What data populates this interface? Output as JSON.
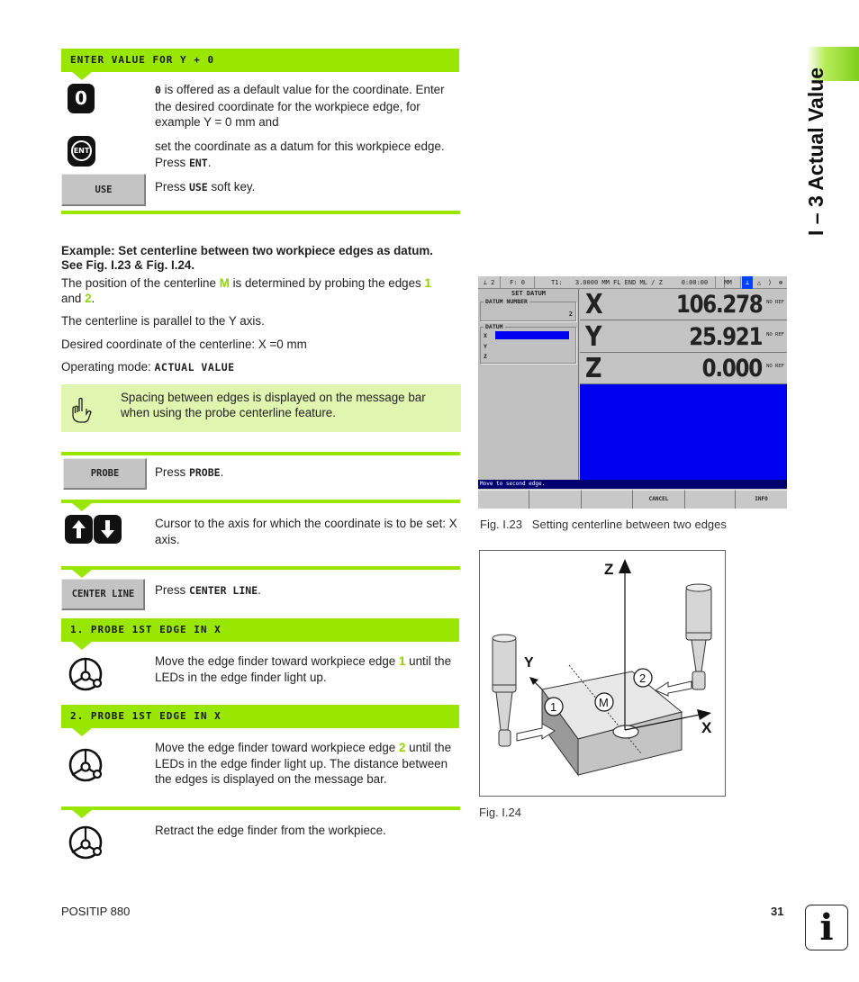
{
  "side_tab": {
    "label": "I – 3 Actual Value",
    "accent": "#99e600"
  },
  "step_enter_value": {
    "header": "ENTER VALUE FOR Y + 0",
    "key_zero": "0",
    "text_zero_key": "0",
    "text_zero_rest": " is offered as a default value for the coordinate. Enter the desired coordinate for the workpiece edge, for example Y = 0 mm and",
    "key_ent": "ENT",
    "text_ent_pre": "set the coordinate as a datum for this workpiece edge. Press ",
    "text_ent_key": "ENT",
    "text_ent_post": ".",
    "softkey_use": "USE",
    "text_use_pre": "Press ",
    "text_use_key": "USE",
    "text_use_post": " soft key."
  },
  "example": {
    "title_line1": "Example: Set centerline between two workpiece edges as datum.",
    "title_line2": "See Fig. I.23 & Fig. I.24.",
    "p1_pre": "The position of the centerline ",
    "p1_m": "M",
    "p1_mid": " is determined by probing the edges ",
    "p1_one": "1",
    "p1_and": "and ",
    "p1_two": "2",
    "p1_end": ".",
    "p2": "The centerline is parallel to the Y axis.",
    "p3": "Desired coordinate of the centerline: X =0 mm",
    "p4_pre": "Operating mode: ",
    "p4_mode": "ACTUAL VALUE"
  },
  "note": {
    "text": "Spacing between edges is displayed on the message bar when using the probe centerline feature.",
    "bg": "#e0f5b0"
  },
  "step_probe": {
    "softkey": "PROBE",
    "text_pre": "Press ",
    "text_key": "PROBE",
    "text_post": "."
  },
  "step_cursor": {
    "text": "Cursor to the axis for which the coordinate is to be set: X axis."
  },
  "step_centerline": {
    "softkey": "CENTER LINE",
    "text_pre": "Press ",
    "text_key": "CENTER LINE",
    "text_post": "."
  },
  "probe1": {
    "header": "1. PROBE 1ST EDGE IN X",
    "text_pre": "Move the edge finder toward workpiece edge ",
    "text_num": "1",
    "text_post": " until the LEDs in the edge finder light up."
  },
  "probe2": {
    "header": "2. PROBE 1ST EDGE IN X",
    "text_pre": "Move the edge finder toward workpiece edge ",
    "text_num": "2",
    "text_post": " until the LEDs in the edge finder light up. The distance between the edges is displayed on the message bar."
  },
  "retract": {
    "text": "Retract the edge finder from the workpiece."
  },
  "dro_screen": {
    "status_bar": {
      "tool_axis": "⟂ 2",
      "feed": "F:  0",
      "tool_label": "T1:",
      "tool_info": "3.0000 MM FL END ML / Z",
      "time": "0:00:00",
      "units": "MM"
    },
    "panel_title": "SET DATUM",
    "datum_number_label": "DATUM NUMBER",
    "datum_number_value": "2",
    "datum_label": "DATUM",
    "datum_axes": [
      "X",
      "Y",
      "Z"
    ],
    "axes": [
      {
        "axis": "X",
        "value": "106.278",
        "ref": "NO REF"
      },
      {
        "axis": "Y",
        "value": "25.921",
        "ref": "NO REF"
      },
      {
        "axis": "Z",
        "value": "0.000",
        "ref": "NO REF"
      }
    ],
    "message": "Move to second edge.",
    "softkeys": [
      "",
      "",
      "",
      "CANCEL",
      "",
      "INFO"
    ]
  },
  "fig23_caption": "Fig. I.23   Setting centerline between two edges",
  "fig24": {
    "caption": "Fig. I.24",
    "labels": {
      "z": "Z",
      "y": "Y",
      "x": "X",
      "m": "M",
      "edge1": "1",
      "edge2": "2"
    }
  },
  "footer": {
    "product": "POSITIP 880",
    "page": "31",
    "info_icon": "i"
  }
}
